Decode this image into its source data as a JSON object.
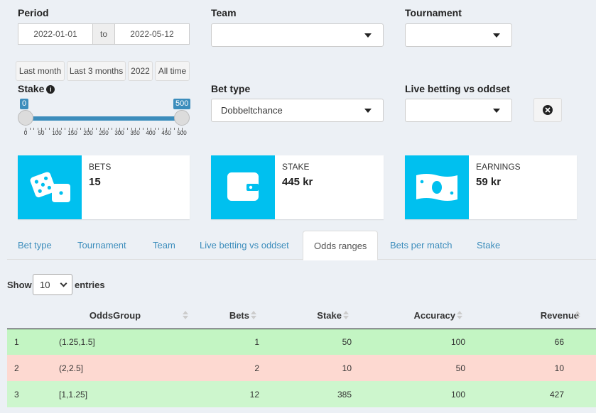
{
  "filters": {
    "period_label": "Period",
    "date_from": "2022-01-01",
    "date_sep": "to",
    "date_to": "2022-05-12",
    "team_label": "Team",
    "team_value": "",
    "tournament_label": "Tournament",
    "tournament_value": "",
    "quick_ranges": [
      "Last month",
      "Last 3 months",
      "2022",
      "All time"
    ],
    "stake_label": "Stake",
    "stake_min": "0",
    "stake_max": "500",
    "stake_ticks": [
      "0",
      "50",
      "100",
      "150",
      "200",
      "250",
      "300",
      "350",
      "400",
      "450",
      "500"
    ],
    "bet_type_label": "Bet type",
    "bet_type_value": "Dobbeltchance",
    "live_label": "Live betting vs oddset",
    "live_value": ""
  },
  "info_boxes": [
    {
      "title": "BETS",
      "value": "15",
      "icon": "dice-icon"
    },
    {
      "title": "STAKE",
      "value": "445 kr",
      "icon": "wallet-icon"
    },
    {
      "title": "EARNINGS",
      "value": "59 kr",
      "icon": "money-bill-icon"
    }
  ],
  "tabs": [
    "Bet type",
    "Tournament",
    "Team",
    "Live betting vs oddset",
    "Odds ranges",
    "Bets per match",
    "Stake"
  ],
  "active_tab": "Odds ranges",
  "table": {
    "show_label": "Show",
    "entries_value": "10",
    "entries_label": "entries",
    "columns": [
      "",
      "OddsGroup",
      "Bets",
      "Stake",
      "Accuracy",
      "Revenue"
    ],
    "rows": [
      {
        "idx": "1",
        "group": "(1.25,1.5]",
        "bets": "1",
        "stake": "50",
        "accuracy": "100",
        "revenue": "66",
        "color": "#c3f5c3"
      },
      {
        "idx": "2",
        "group": "(2,2.5]",
        "bets": "2",
        "stake": "10",
        "accuracy": "50",
        "revenue": "10",
        "color": "#fdd9d1"
      },
      {
        "idx": "3",
        "group": "[1,1.25]",
        "bets": "12",
        "stake": "385",
        "accuracy": "100",
        "revenue": "427",
        "color": "#cdf6cd"
      }
    ]
  },
  "colors": {
    "accent": "#3c8dbc",
    "icon_bg": "#00c0ef",
    "bg": "#ecf0f5"
  }
}
